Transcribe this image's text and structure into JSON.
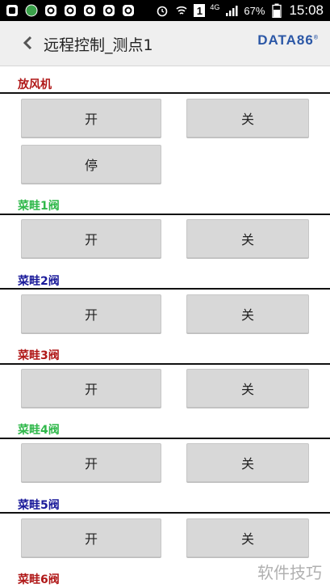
{
  "status": {
    "time": "15:08",
    "battery_pct": "67%",
    "network": "4G",
    "notif_number": "1"
  },
  "header": {
    "title": "远程控制_测点1",
    "brand": "DATA86",
    "brand_mark": "®"
  },
  "sections": [
    {
      "label": "放风机",
      "color": "#b01818",
      "buttons": [
        "开",
        "关",
        "停"
      ]
    },
    {
      "label": "菜畦1阀",
      "color": "#2fb84a",
      "buttons": [
        "开",
        "关"
      ]
    },
    {
      "label": "菜畦2阀",
      "color": "#1a1a9a",
      "buttons": [
        "开",
        "关"
      ]
    },
    {
      "label": "菜畦3阀",
      "color": "#b01818",
      "buttons": [
        "开",
        "关"
      ]
    },
    {
      "label": "菜畦4阀",
      "color": "#2fb84a",
      "buttons": [
        "开",
        "关"
      ]
    },
    {
      "label": "菜畦5阀",
      "color": "#1a1a9a",
      "buttons": [
        "开",
        "关"
      ]
    },
    {
      "label": "菜畦6阀",
      "color": "#b01818",
      "buttons": []
    }
  ],
  "watermark": "软件技巧"
}
